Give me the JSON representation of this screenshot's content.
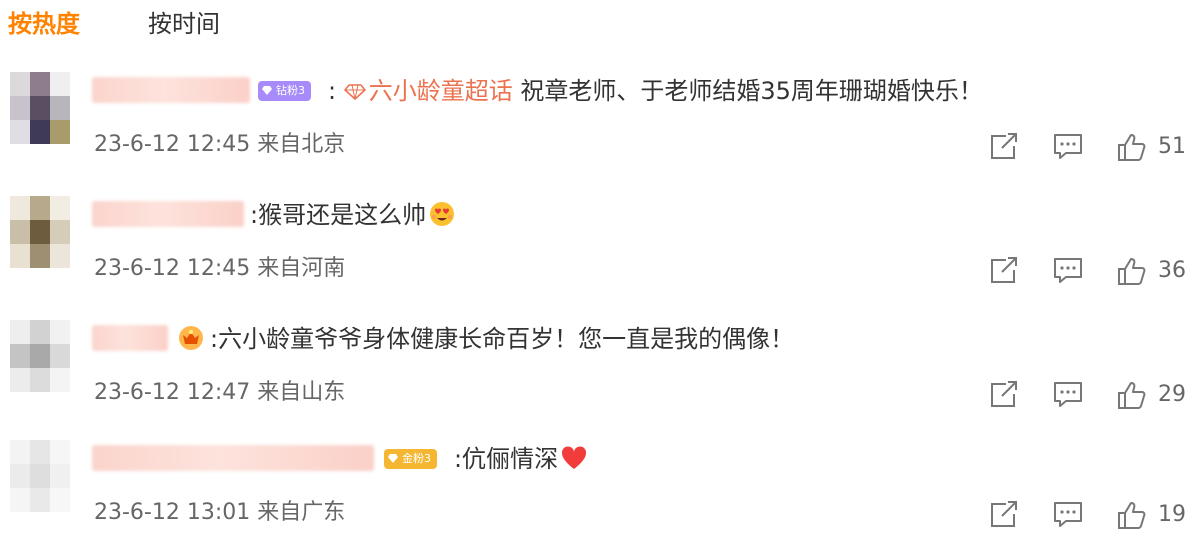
{
  "tabs": {
    "hot": "按热度",
    "time": "按时间"
  },
  "colors": {
    "accent": "#ff8200",
    "topic": "#eb7350",
    "meta": "#666666"
  },
  "comments": [
    {
      "badge": "钻粉3",
      "prefix": ":",
      "topic": "六小龄童超话",
      "text": "祝章老师、于老师结婚35周年珊瑚婚快乐！",
      "time": "23-6-12 12:45",
      "location": "来自北京",
      "likes": "51"
    },
    {
      "prefix": ":",
      "text": "猴哥还是这么帅",
      "emoji": "heart-eyes-emoji",
      "time": "23-6-12 12:45",
      "location": "来自河南",
      "likes": "36"
    },
    {
      "prefix": ":",
      "text": "六小龄童爷爷身体健康长命百岁！您一直是我的偶像！",
      "badge_icon": "crown-badge-icon",
      "time": "23-6-12 12:47",
      "location": "来自山东",
      "likes": "29"
    },
    {
      "badge": "金粉3",
      "prefix": ":",
      "text": "伉俪情深",
      "emoji": "red-heart-emoji",
      "time": "23-6-12 13:01",
      "location": "来自广东",
      "likes": "19"
    }
  ],
  "icons": {
    "share": "share-icon",
    "comment": "comment-icon",
    "like": "thumbs-up-icon",
    "topic": "diamond-topic-icon"
  }
}
